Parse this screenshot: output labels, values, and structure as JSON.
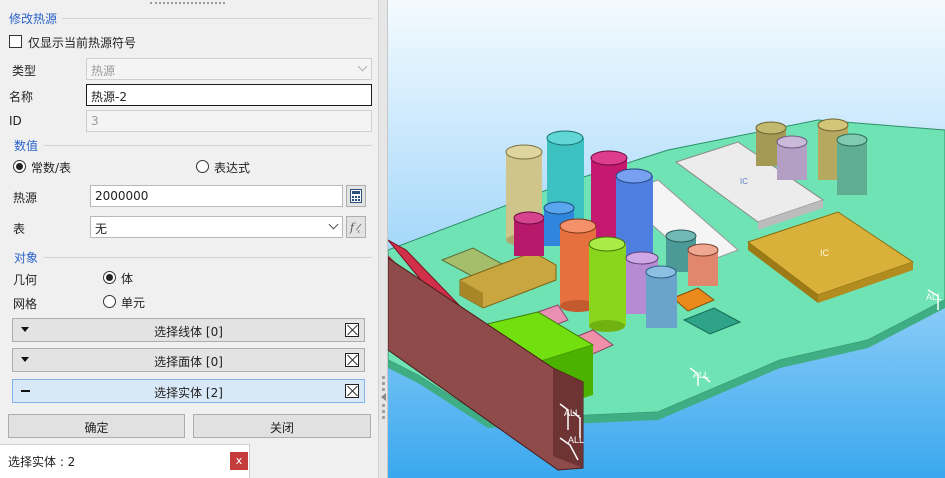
{
  "panel": {
    "section_modify": "修改热源",
    "show_current_only": {
      "label": "仅显示当前热源符号",
      "checked": false
    },
    "type": {
      "label": "类型",
      "value": "热源"
    },
    "name": {
      "label": "名称",
      "value": "热源-2"
    },
    "id": {
      "label": "ID",
      "value": "3"
    },
    "section_value": "数值",
    "value_mode": {
      "constant_label": "常数/表",
      "expression_label": "表达式",
      "selected": "constant"
    },
    "heat_source": {
      "label": "热源",
      "value": "2000000",
      "icon": "calculator-icon"
    },
    "table": {
      "label": "表",
      "value": "无",
      "icon": "function-icon"
    },
    "section_object": "对象",
    "geometry": {
      "label": "几何",
      "option": "体",
      "selected": true
    },
    "mesh": {
      "label": "网格",
      "option": "单元",
      "selected": false
    },
    "selections": [
      {
        "label": "选择线体 [0]",
        "state": "collapsed"
      },
      {
        "label": "选择面体 [0]",
        "state": "collapsed"
      },
      {
        "label": "选择实体 [2]",
        "state": "active"
      }
    ],
    "ok_label": "确定",
    "close_label": "关闭"
  },
  "status": {
    "text": "选择实体 : 2",
    "close_label": "x"
  },
  "viewport": {
    "annotations": [
      "ALL",
      "ALL",
      "ALL",
      "ALL",
      "IC",
      "IC"
    ],
    "colors": {
      "background_top": "#f4fbff",
      "background_bottom": "#3aa8ee",
      "board": "#6fe3b3"
    }
  }
}
